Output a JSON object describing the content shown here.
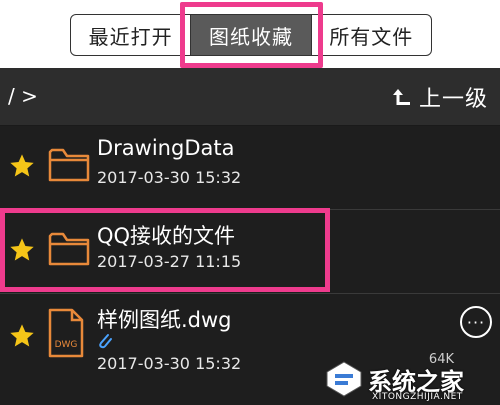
{
  "tabs": [
    {
      "label": "最近打开",
      "active": false
    },
    {
      "label": "图纸收藏",
      "active": true
    },
    {
      "label": "所有文件",
      "active": false
    }
  ],
  "path_bar": {
    "path": "/ >",
    "up_label": "上一级",
    "up_icon": "up-level-arrow-icon"
  },
  "files": [
    {
      "name": "DrawingData",
      "date": "2017-03-30 15:32",
      "type": "folder",
      "starred": true
    },
    {
      "name": "QQ接收的文件",
      "date": "2017-03-27 11:15",
      "type": "folder",
      "starred": true
    },
    {
      "name": "样例图纸.dwg",
      "date": "2017-03-30 15:32",
      "type": "dwg",
      "starred": true,
      "file_icon_label": "DWG",
      "size": "64K",
      "more_label": "···"
    }
  ],
  "watermark": {
    "text": "系统之家",
    "sub": "XITONGZHIJIA.NET"
  },
  "colors": {
    "highlight": "#ee3b8d",
    "star": "#f5c518",
    "folder": "#e8893a",
    "list_bg": "#1e1e1e",
    "path_bg": "#2d2d2d",
    "active_tab": "#5a5a5a"
  }
}
